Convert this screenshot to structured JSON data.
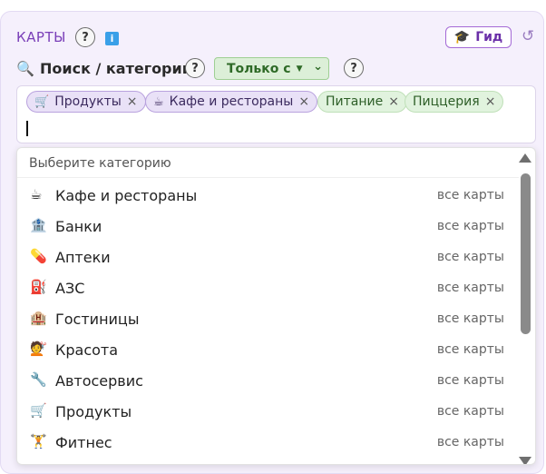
{
  "header": {
    "title": "КАРТЫ",
    "help_q": "?",
    "info_label": "i",
    "guide_icon": "🎓",
    "guide_label": "Гид",
    "reset_icon": "↺"
  },
  "search": {
    "icon": "🔍",
    "label": "Поиск / категории",
    "help_q": "?",
    "mode_value": "Только с",
    "mode_caret": "▼",
    "mode_chevron": "⌄",
    "mode_help_q": "?"
  },
  "tags": [
    {
      "icon": "🛒",
      "label": "Продукты",
      "remove": "×"
    },
    {
      "icon": "☕",
      "label": "Кафе и рестораны",
      "remove": "×"
    },
    {
      "icon": "",
      "label": "Питание",
      "remove": "×"
    },
    {
      "icon": "",
      "label": "Пиццерия",
      "remove": "×"
    }
  ],
  "dropdown": {
    "header": "Выберите категорию",
    "options": [
      {
        "icon": "☕",
        "label": "Кафе и рестораны",
        "scope": "все карты"
      },
      {
        "icon": "🏦",
        "label": "Банки",
        "scope": "все карты"
      },
      {
        "icon": "💊",
        "label": "Аптеки",
        "scope": "все карты"
      },
      {
        "icon": "⛽",
        "label": "АЗС",
        "scope": "все карты"
      },
      {
        "icon": "🏨",
        "label": "Гостиницы",
        "scope": "все карты"
      },
      {
        "icon": "💇",
        "label": "Красота",
        "scope": "все карты"
      },
      {
        "icon": "🔧",
        "label": "Автосервис",
        "scope": "все карты"
      },
      {
        "icon": "🛒",
        "label": "Продукты",
        "scope": "все карты"
      },
      {
        "icon": "🏋",
        "label": "Фитнес",
        "scope": "все карты"
      }
    ]
  },
  "colors": {
    "accent": "#7a3fb8",
    "tag_purple": "#e9e1f7",
    "tag_green": "#e1f3de",
    "mode_green": "#dcefd8"
  }
}
